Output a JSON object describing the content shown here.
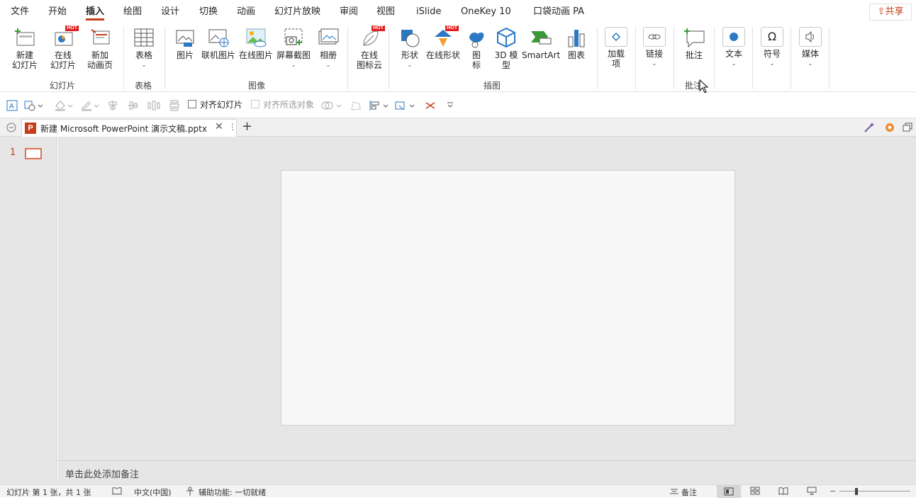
{
  "menu": {
    "tabs": [
      "文件",
      "开始",
      "插入",
      "绘图",
      "设计",
      "切换",
      "动画",
      "幻灯片放映",
      "审阅",
      "视图",
      "iSlide",
      "OneKey 10",
      "口袋动画 PA"
    ],
    "active_tab": "插入",
    "share_label": "共享"
  },
  "ribbon": {
    "hot_badge": "HOT",
    "slides": {
      "new_slide": "新建\n幻灯片",
      "online_slide": "在线\n幻灯片",
      "new_anim_page": "新加\n动画页",
      "group": "幻灯片"
    },
    "tables": {
      "table": "表格",
      "group": "表格"
    },
    "images": {
      "picture": "图片",
      "online_pic": "联机图片",
      "web_pic": "在线图片",
      "screenshot": "屏幕截图",
      "album": "相册",
      "group": "图像"
    },
    "online_icon": {
      "label": "在线\n图标云"
    },
    "illus": {
      "shapes": "形状",
      "online_shapes": "在线形状",
      "icons": "图\n标",
      "model3d": "3D 模\n型",
      "smartart": "SmartArt",
      "chart": "图表",
      "group": "插图"
    },
    "addins": {
      "label": "加载\n项"
    },
    "links": {
      "label": "链接"
    },
    "comments": {
      "label": "批注",
      "group": "批注"
    },
    "text": {
      "label": "文本"
    },
    "symbols": {
      "label": "符号"
    },
    "media": {
      "label": "媒体"
    }
  },
  "qat": {
    "align_slide": "对齐幻灯片",
    "align_selected": "对齐所选对象"
  },
  "document": {
    "tab_title": "新建 Microsoft PowerPoint 演示文稿.pptx"
  },
  "thumbs": {
    "slide_number": "1"
  },
  "notes": {
    "placeholder": "单击此处添加备注"
  },
  "status": {
    "slide_info": "幻灯片 第 1 张，共 1 张",
    "language": "中文(中国)",
    "accessibility": "辅助功能: 一切就绪",
    "notes_label": "备注"
  },
  "colors": {
    "accent": "#c43e1c",
    "hot": "#e02020",
    "icon_blue": "#2b79c2"
  }
}
